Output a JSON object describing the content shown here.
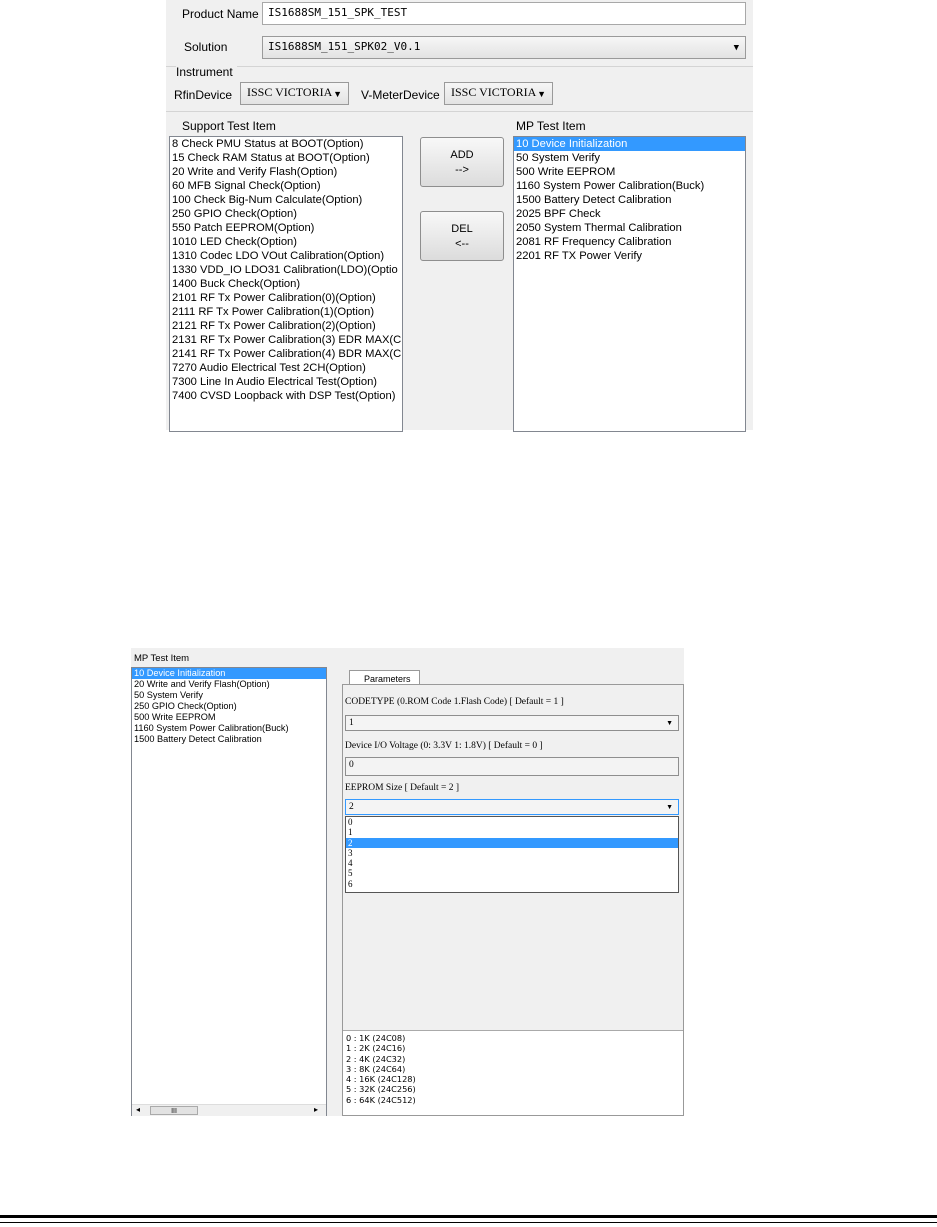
{
  "shot1": {
    "product_name_label": "Product Name",
    "product_name_value": "IS1688SM_151_SPK_TEST",
    "solution_label": "Solution",
    "solution_value": "IS1688SM_151_SPK02_V0.1",
    "instrument_label": "Instrument",
    "rfin_label": "RfinDevice",
    "rfin_value": "ISSC VICTORIA",
    "vmeter_label": "V-MeterDevice",
    "vmeter_value": "ISSC VICTORIA",
    "support_header": "Support Test Item",
    "mp_header": "MP Test Item",
    "add_button": "ADD\n-->",
    "del_button": "DEL\n<--",
    "support_items": [
      "8 Check PMU Status at BOOT(Option)",
      "15 Check RAM Status at BOOT(Option)",
      "20 Write and Verify Flash(Option)",
      "60 MFB Signal Check(Option)",
      "100 Check Big-Num Calculate(Option)",
      "250 GPIO Check(Option)",
      "550 Patch EEPROM(Option)",
      "1010 LED Check(Option)",
      "1310 Codec LDO VOut Calibration(Option)",
      "1330 VDD_IO LDO31 Calibration(LDO)(Optio",
      "1400 Buck Check(Option)",
      "2101 RF Tx Power Calibration(0)(Option)",
      "2111 RF Tx Power Calibration(1)(Option)",
      "2121 RF Tx Power Calibration(2)(Option)",
      "2131 RF Tx Power Calibration(3) EDR MAX(C",
      "2141 RF Tx Power Calibration(4) BDR MAX(C",
      "7270 Audio Electrical Test 2CH(Option)",
      "7300 Line In Audio Electrical Test(Option)",
      "7400 CVSD Loopback with DSP Test(Option)"
    ],
    "mp_items": [
      "10 Device Initialization",
      "50 System Verify",
      "500 Write EEPROM",
      "1160 System Power Calibration(Buck)",
      "1500 Battery Detect Calibration",
      "2025 BPF Check",
      "2050 System Thermal Calibration",
      "2081 RF Frequency Calibration",
      "2201 RF TX Power Verify"
    ],
    "mp_selected_index": 0
  },
  "shot2": {
    "mp_header": "MP Test Item",
    "mp_items": [
      "10 Device Initialization",
      "20 Write and Verify Flash(Option)",
      "50 System Verify",
      "250 GPIO Check(Option)",
      "500 Write EEPROM",
      "1160 System Power Calibration(Buck)",
      "1500 Battery Detect Calibration"
    ],
    "mp_selected_index": 0,
    "tab_label": "Parameters",
    "codetype_label": "CODETYPE (0.ROM Code 1.Flash Code) [ Default = 1 ]",
    "codetype_value": "1",
    "voltage_label": "Device I/O Voltage (0: 3.3V 1: 1.8V) [ Default = 0 ]",
    "voltage_value": "0",
    "eeprom_label": "EEPROM Size [ Default = 2 ]",
    "eeprom_value": "2",
    "eeprom_options": [
      "0",
      "1",
      "2",
      "3",
      "4",
      "5",
      "6"
    ],
    "eeprom_selected_index": 2,
    "eeprom_descriptions": [
      "0 :  1K (24C08)",
      "1 :  2K (24C16)",
      "2 :  4K (24C32)",
      "3 :  8K (24C64)",
      "4 : 16K (24C128)",
      "5 : 32K (24C256)",
      "6 : 64K (24C512)"
    ],
    "scroll_thumb": "III"
  },
  "colors": {
    "selection": "#3399ff",
    "window_bg": "#f0f0f0"
  }
}
